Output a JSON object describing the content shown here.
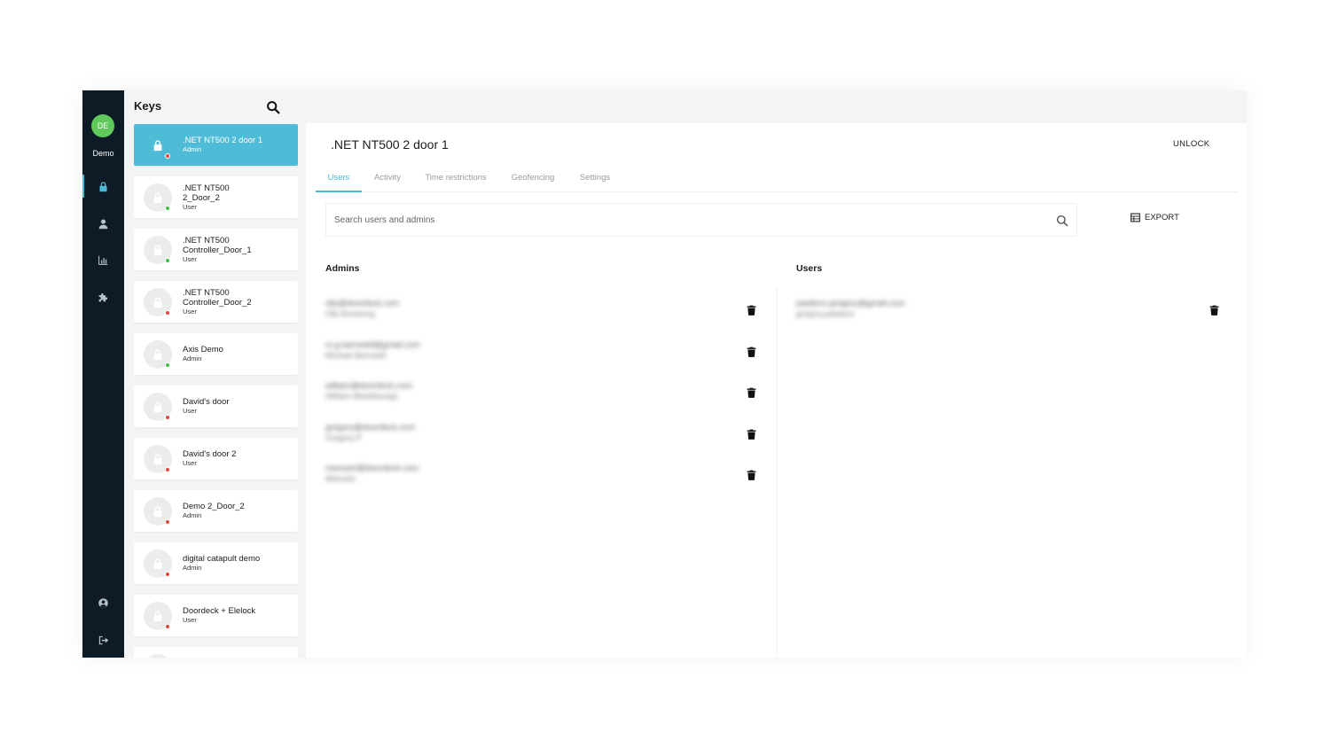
{
  "user": {
    "initials": "DE",
    "name": "Demo",
    "avatar_color": "#5fc95a"
  },
  "colors": {
    "accent": "#4ebcd6",
    "rail_bg": "#0c1b26",
    "status_green": "#3cc24a",
    "status_red": "#e2453c"
  },
  "nav": {
    "top": [
      {
        "icon": "lock-icon",
        "active": true
      },
      {
        "icon": "user-icon",
        "active": false
      },
      {
        "icon": "chart-icon",
        "active": false
      },
      {
        "icon": "puzzle-icon",
        "active": false
      }
    ],
    "bottom": [
      {
        "icon": "account-circle-icon"
      },
      {
        "icon": "logout-icon"
      }
    ]
  },
  "keys": {
    "title": "Keys",
    "search_icon": "search-icon",
    "items": [
      {
        "name": ".NET NT500 2 door 1",
        "role": "Admin",
        "status": "red",
        "selected": true
      },
      {
        "name": ".NET NT500\n2_Door_2",
        "role": "User",
        "status": "green",
        "selected": false
      },
      {
        "name": ".NET NT500\nController_Door_1",
        "role": "User",
        "status": "green",
        "selected": false
      },
      {
        "name": ".NET NT500\nController_Door_2",
        "role": "User",
        "status": "red",
        "selected": false
      },
      {
        "name": "Axis Demo",
        "role": "Admin",
        "status": "green",
        "selected": false
      },
      {
        "name": "David's door",
        "role": "User",
        "status": "red",
        "selected": false
      },
      {
        "name": "David's door 2",
        "role": "User",
        "status": "red",
        "selected": false
      },
      {
        "name": "Demo 2_Door_2",
        "role": "Admin",
        "status": "red",
        "selected": false
      },
      {
        "name": "digital catapult demo",
        "role": "Admin",
        "status": "red",
        "selected": false
      },
      {
        "name": "Doordeck + Elelock",
        "role": "User",
        "status": "red",
        "selected": false
      },
      {
        "name": "",
        "role": "",
        "status": "red",
        "selected": false
      }
    ]
  },
  "door": {
    "title": ".NET NT500 2 door 1",
    "unlock_label": "UNLOCK",
    "tabs": [
      {
        "label": "Users",
        "active": true
      },
      {
        "label": "Activity",
        "active": false
      },
      {
        "label": "Time restrictions",
        "active": false
      },
      {
        "label": "Geofencing",
        "active": false
      },
      {
        "label": "Settings",
        "active": false
      }
    ],
    "search": {
      "placeholder": "Search users and admins",
      "value": ""
    },
    "export_label": "EXPORT",
    "admins_title": "Admins",
    "users_title": "Users",
    "admins": [
      {
        "email": "olly@doordeck.com",
        "name": "Olly Browning"
      },
      {
        "email": "m.g.barnwell@gmail.com",
        "name": "Michael Barnwell"
      },
      {
        "email": "william@doordeck.com",
        "name": "William Blankbourgh"
      },
      {
        "email": "gregory@doordeck.com",
        "name": "Gregory P"
      },
      {
        "email": "mansani@doordeck.com",
        "name": "Mansani"
      }
    ],
    "users": [
      {
        "email": "pawlens.gregory@gmail.com",
        "name": "gregory.pawlens"
      }
    ]
  }
}
